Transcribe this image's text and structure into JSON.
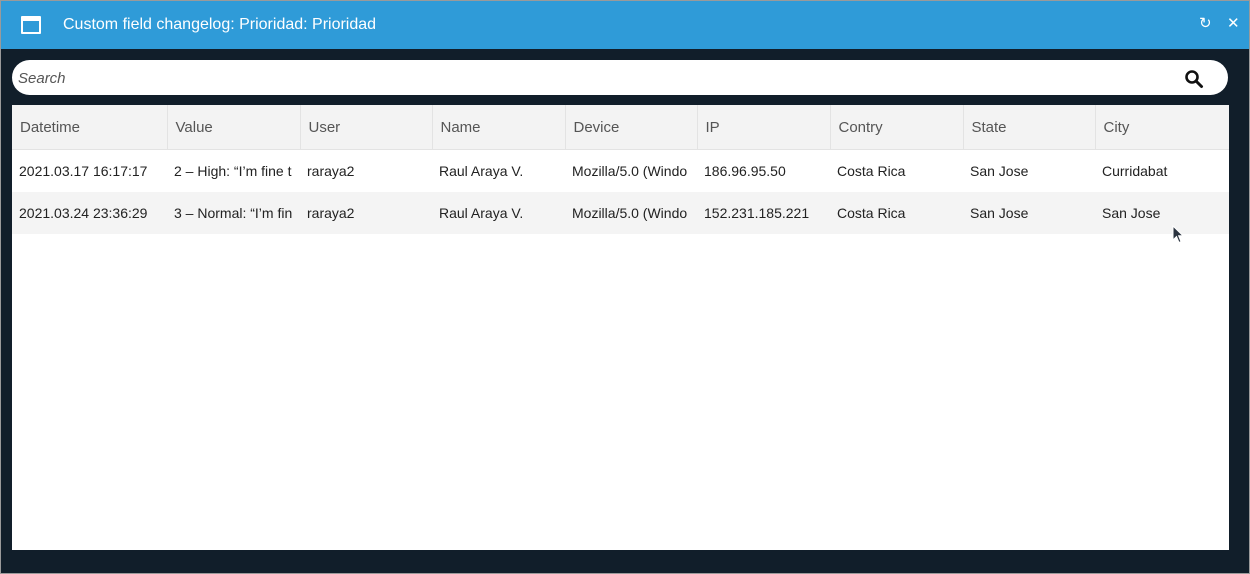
{
  "window": {
    "title": "Custom field changelog: Prioridad: Prioridad",
    "refresh_icon": "↻",
    "close_icon": "✕"
  },
  "search": {
    "placeholder": "Search"
  },
  "table": {
    "columns": [
      "Datetime",
      "Value",
      "User",
      "Name",
      "Device",
      "IP",
      "Contry",
      "State",
      "City"
    ],
    "rows": [
      {
        "datetime": "2021.03.17 16:17:17",
        "value": "2 – High: “I’m fine t",
        "user": "raraya2",
        "name": "Raul Araya V.",
        "device": "Mozilla/5.0 (Windo",
        "ip": "186.96.95.50",
        "country": "Costa Rica",
        "state": "San Jose",
        "city": "Curridabat"
      },
      {
        "datetime": "2021.03.24 23:36:29",
        "value": "3 – Normal: “I’m fin",
        "user": "raraya2",
        "name": "Raul Araya V.",
        "device": "Mozilla/5.0 (Windo",
        "ip": "152.231.185.221",
        "country": "Costa Rica",
        "state": "San Jose",
        "city": "San Jose"
      }
    ]
  },
  "colors": {
    "titlebar": "#2f9bd8",
    "frame": "#111e2a"
  }
}
